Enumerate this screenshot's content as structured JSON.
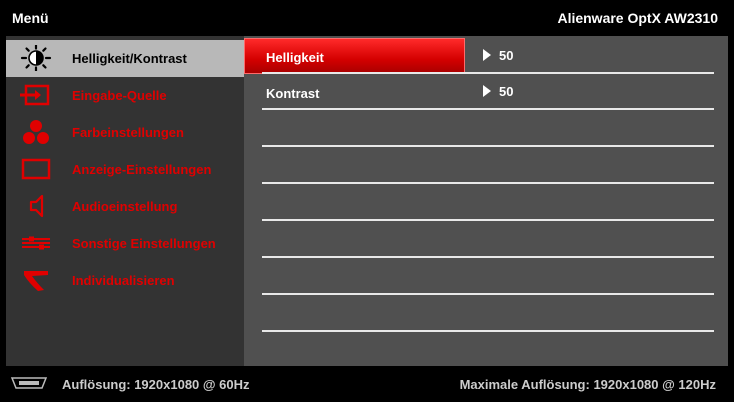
{
  "header": {
    "menu_title": "Menü",
    "model": "Alienware OptX AW2310"
  },
  "sidebar": {
    "items": [
      {
        "label": "Helligkeit/Kontrast",
        "icon": "brightness-icon",
        "active": true
      },
      {
        "label": "Eingabe-Quelle",
        "icon": "input-source-icon",
        "active": false
      },
      {
        "label": "Farbeinstellungen",
        "icon": "color-settings-icon",
        "active": false
      },
      {
        "label": "Anzeige-Einstellungen",
        "icon": "display-settings-icon",
        "active": false
      },
      {
        "label": "Audioeinstellung",
        "icon": "speaker-icon",
        "active": false
      },
      {
        "label": "Sonstige Einstellungen",
        "icon": "other-settings-icon",
        "active": false
      },
      {
        "label": "Individualisieren",
        "icon": "personalize-icon",
        "active": false
      }
    ]
  },
  "content": {
    "rows": [
      {
        "label": "Helligkeit",
        "value": "50",
        "selected": true
      },
      {
        "label": "Kontrast",
        "value": "50",
        "selected": false
      }
    ]
  },
  "footer": {
    "resolution": "Auflösung: 1920x1080 @ 60Hz",
    "max_resolution": "Maximale Auflösung: 1920x1080 @ 120Hz"
  },
  "colors": {
    "accent": "#e00000",
    "sidebar_bg": "#333333",
    "content_bg": "#505050",
    "active_item_bg": "#b8b8b8"
  }
}
